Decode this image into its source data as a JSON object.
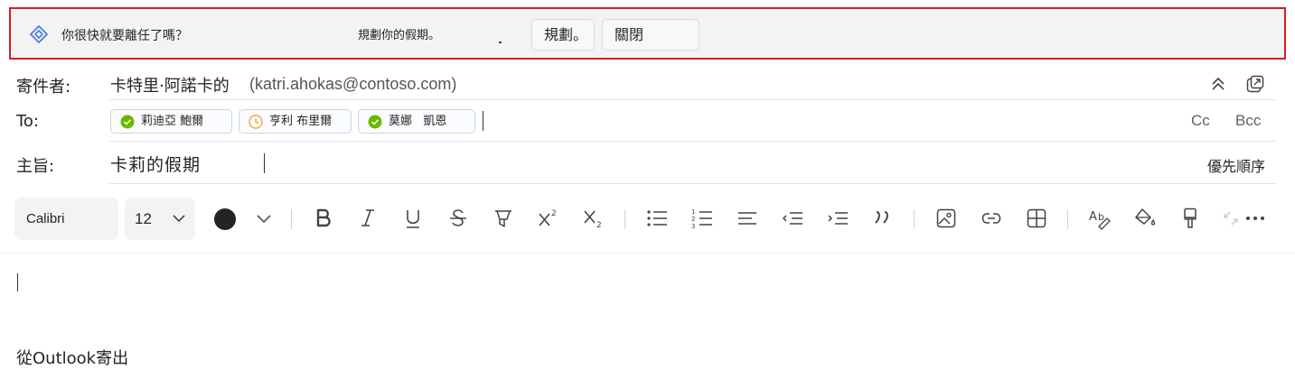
{
  "banner": {
    "icon": "plan-diamond-icon",
    "message": "你很快就要離任了嗎？",
    "secondary_text": "規劃你的假期。",
    "plan_button": "規劃。",
    "close_button": "關閉"
  },
  "from": {
    "label": "寄件者:",
    "name": "卡特里·阿諾卡的",
    "email": "(katri.ahokas@contoso.com)",
    "icons": [
      "collapse-chevrons-icon",
      "pop-out-icon"
    ]
  },
  "to": {
    "label": "To:",
    "recipients": [
      {
        "name": "莉迪亞 鮑爾",
        "status": "available",
        "status_icon": "check-circle-icon",
        "color": "#6bb700"
      },
      {
        "name": "亨利 布里爾",
        "status": "away",
        "status_icon": "clock-icon",
        "color": "#f4a23b"
      },
      {
        "name": "莫娜   凱恩",
        "status": "available",
        "status_icon": "check-circle-icon",
        "color": "#6bb700"
      }
    ],
    "cc": "Cc",
    "bcc": "Bcc"
  },
  "subject": {
    "label": "主旨:",
    "value": "卡莉的假期",
    "priority": "優先順序"
  },
  "toolbar": {
    "font_name": "Calibri",
    "font_size": "12",
    "text_color": "#242424",
    "tools": [
      "font-color-dropdown-icon",
      "bold-icon",
      "italic-icon",
      "underline-icon",
      "strikethrough-icon",
      "highlight-icon",
      "superscript-icon",
      "subscript-icon",
      "bullets-icon",
      "numbering-icon",
      "align-icon",
      "decrease-indent-icon",
      "increase-indent-icon",
      "quote-icon",
      "insert-picture-icon",
      "link-icon",
      "table-icon",
      "spelling-icon",
      "fill-color-icon",
      "format-painter-icon",
      "expand-icon",
      "more-icon"
    ]
  },
  "body": {
    "signature": "從Outlook寄出"
  },
  "colors": {
    "banner_border": "#d71e1e",
    "banner_bg": "#f3f3f3",
    "chip_border": "#c4d6ec"
  }
}
